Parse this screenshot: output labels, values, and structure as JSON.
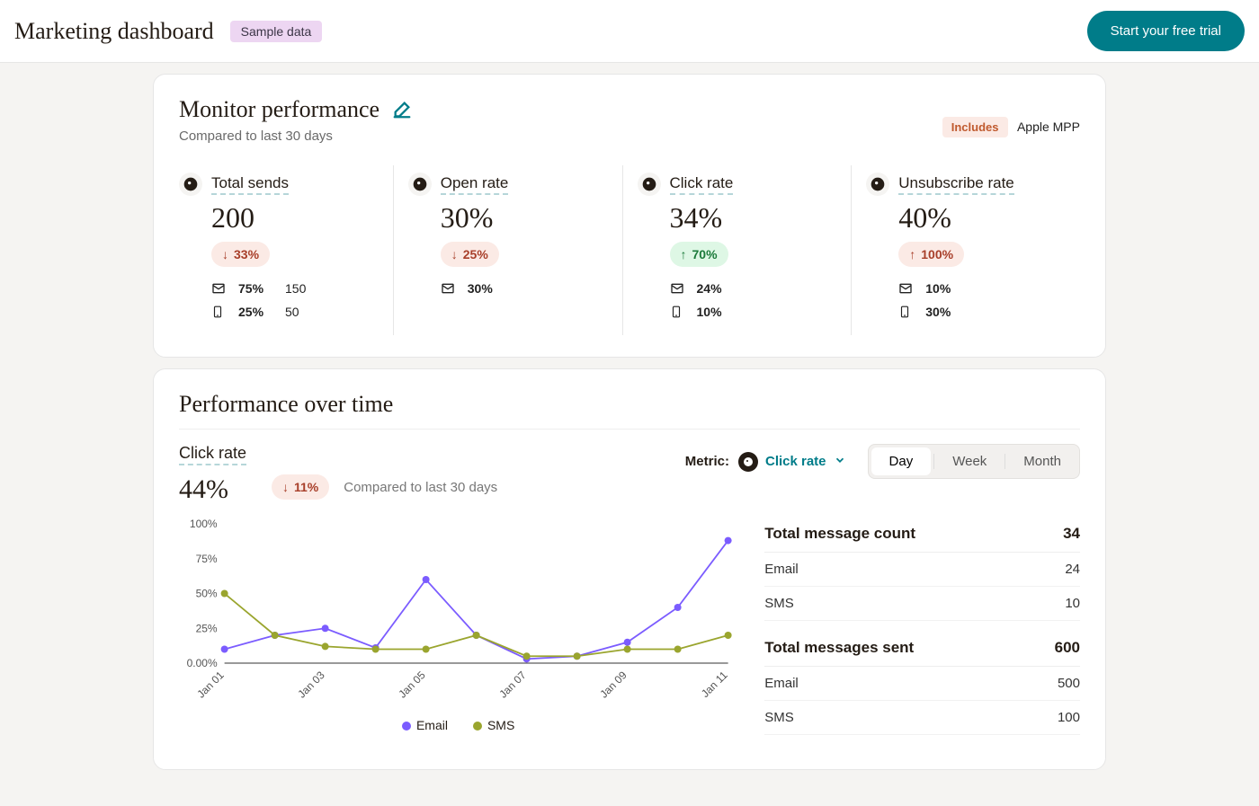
{
  "header": {
    "title": "Marketing dashboard",
    "sample_badge": "Sample data",
    "cta": "Start your free trial"
  },
  "monitor": {
    "title": "Monitor performance",
    "subtitle": "Compared to last 30 days",
    "includes_label": "Includes",
    "includes_value": "Apple MPP",
    "metrics": [
      {
        "label": "Total sends",
        "value": "200",
        "delta": "33%",
        "delta_dir": "down",
        "breakdown": [
          {
            "channel": "email",
            "pct": "75%",
            "count": "150"
          },
          {
            "channel": "sms",
            "pct": "25%",
            "count": "50"
          }
        ]
      },
      {
        "label": "Open rate",
        "value": "30%",
        "delta": "25%",
        "delta_dir": "down",
        "breakdown": [
          {
            "channel": "email",
            "pct": "30%"
          }
        ]
      },
      {
        "label": "Click rate",
        "value": "34%",
        "delta": "70%",
        "delta_dir": "up",
        "breakdown": [
          {
            "channel": "email",
            "pct": "24%"
          },
          {
            "channel": "sms",
            "pct": "10%"
          }
        ]
      },
      {
        "label": "Unsubscribe rate",
        "value": "40%",
        "delta": "100%",
        "delta_dir": "up-bad",
        "breakdown": [
          {
            "channel": "email",
            "pct": "10%"
          },
          {
            "channel": "sms",
            "pct": "30%"
          }
        ]
      }
    ]
  },
  "over_time": {
    "title": "Performance over time",
    "metric_label": "Click rate",
    "metric_value": "44%",
    "delta": "11%",
    "delta_dir": "down",
    "compared": "Compared to last 30 days",
    "picker_label": "Metric:",
    "picker_value": "Click rate",
    "segments": [
      "Day",
      "Week",
      "Month"
    ],
    "segment_active": "Day",
    "legend": {
      "email": "Email",
      "sms": "SMS"
    },
    "summary": [
      {
        "head": "Total message count",
        "head_val": "34",
        "rows": [
          {
            "k": "Email",
            "v": "24"
          },
          {
            "k": "SMS",
            "v": "10"
          }
        ]
      },
      {
        "head": "Total messages sent",
        "head_val": "600",
        "rows": [
          {
            "k": "Email",
            "v": "500"
          },
          {
            "k": "SMS",
            "v": "100"
          }
        ]
      }
    ]
  },
  "chart_data": {
    "type": "line",
    "xlabel": "",
    "ylabel": "",
    "ylim": [
      0,
      100
    ],
    "y_ticks": [
      "0.00%",
      "25%",
      "50%",
      "75%",
      "100%"
    ],
    "categories": [
      "Jan 01",
      "Jan 02",
      "Jan 03",
      "Jan 04",
      "Jan 05",
      "Jan 06",
      "Jan 07",
      "Jan 08",
      "Jan 09",
      "Jan 10",
      "Jan 11"
    ],
    "x_tick_labels": [
      "Jan 01",
      "Jan 03",
      "Jan 05",
      "Jan 07",
      "Jan 09",
      "Jan 11"
    ],
    "series": [
      {
        "name": "Email",
        "color": "#7b5cff",
        "values": [
          10,
          20,
          25,
          11,
          60,
          20,
          3,
          5,
          15,
          40,
          88
        ]
      },
      {
        "name": "SMS",
        "color": "#9aa52e",
        "values": [
          50,
          20,
          12,
          10,
          10,
          20,
          5,
          5,
          10,
          10,
          20
        ]
      }
    ]
  },
  "colors": {
    "teal": "#007c89",
    "purple": "#7b5cff",
    "olive": "#9aa52e",
    "red_bg": "#fbeae5",
    "red_fg": "#a83f2a",
    "green_bg": "#def7e5",
    "green_fg": "#1b7a3a"
  }
}
